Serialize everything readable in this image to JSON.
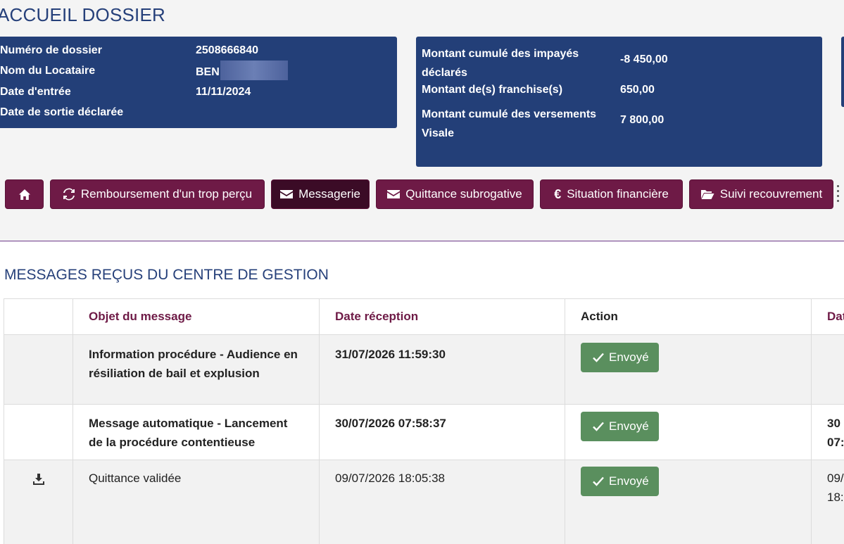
{
  "header": {
    "title": "ACCUEIL DOSSIER"
  },
  "dossier": {
    "numero_label": "Numéro de dossier",
    "numero_value": "2508666840",
    "locataire_label": "Nom du Locataire",
    "locataire_value": "BEN",
    "entree_label": "Date d'entrée",
    "entree_value": "11/11/2024",
    "sortie_label": "Date de sortie déclarée",
    "sortie_value": ""
  },
  "montants": {
    "impayes_label": "Montant cumulé des impayés déclarés",
    "impayes_value": "-8 450,00",
    "franchise_label": "Montant de(s) franchise(s)",
    "franchise_value": "650,00",
    "versements_label": "Montant cumulé des versements Visale",
    "versements_value": "7 800,00"
  },
  "toolbar": {
    "home_icon": "home-icon",
    "remboursement_label": "Remboursement d'un trop perçu",
    "messagerie_label": "Messagerie",
    "quittance_label": "Quittance subrogative",
    "situation_label": "Situation financière",
    "suivi_label": "Suivi recouvrement"
  },
  "section": {
    "title": "MESSAGES REÇUS DU CENTRE DE GESTION"
  },
  "table": {
    "headers": {
      "col0": "",
      "objet": "Objet du message",
      "date_reception": "Date réception",
      "action": "Action",
      "col4": "Dat"
    },
    "rows": [
      {
        "objet": "Information procédure - Audience en résiliation de bail et explusion",
        "date": "31/07/2026 11:59:30",
        "action": "Envoyé",
        "col4": ""
      },
      {
        "objet": "Message automatique - Lancement de la procédure contentieuse",
        "date": "30/07/2026 07:58:37",
        "action": "Envoyé",
        "col4_line1": "30",
        "col4_line2": "07:"
      },
      {
        "objet": "Quittance validée",
        "date": "09/07/2026 18:05:38",
        "action": "Envoyé",
        "col4_line1": "09/",
        "col4_line2": "18:"
      }
    ]
  },
  "colors": {
    "navy": "#233f78",
    "plum": "#6e1a46",
    "plum_active": "#3b0b26",
    "green": "#5a8f5e"
  }
}
